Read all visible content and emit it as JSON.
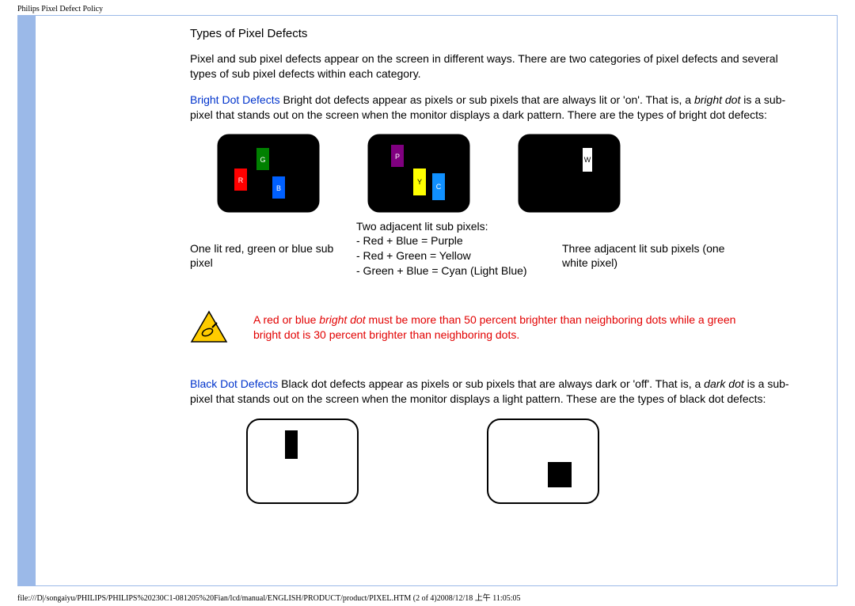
{
  "header": {
    "title": "Philips Pixel Defect Policy"
  },
  "section": {
    "heading": "Types of Pixel Defects",
    "intro": "Pixel and sub pixel defects appear on the screen in different ways. There are two categories of pixel defects and several types of sub pixel defects within each category.",
    "bright_label": "Bright Dot Defects",
    "bright_text_1": " Bright dot defects appear as pixels or sub pixels that are always lit or 'on'. That is, a ",
    "bright_em": "bright dot",
    "bright_text_2": " is a sub-pixel that stands out on the screen when the monitor displays a dark pattern. There are the types of bright dot defects:",
    "captions": {
      "c1": "One lit red, green or blue sub pixel",
      "c2_hdr": "Two adjacent lit sub pixels:",
      "c2_l1": "- Red + Blue = Purple",
      "c2_l2": "- Red + Green = Yellow",
      "c2_l3": "- Green + Blue = Cyan (Light Blue)",
      "c3": "Three adjacent lit sub pixels (one white pixel)"
    },
    "warning_1": "A red or blue ",
    "warning_em": "bright dot",
    "warning_2": " must be more than 50 percent brighter than neighboring dots while a green bright dot is 30 percent brighter than neighboring dots.",
    "black_label": "Black Dot Defects",
    "black_text_1": " Black dot defects appear as pixels or sub pixels that are always dark or 'off'. That is, a ",
    "black_em": "dark dot",
    "black_text_2": " is a sub-pixel that stands out on the screen when the monitor displays a light pattern. These are the types of black dot defects:"
  },
  "footer": {
    "path": "file:///D|/songaiyu/PHILIPS/PHILIPS%20230C1-081205%20Fian/lcd/manual/ENGLISH/PRODUCT/product/PIXEL.HTM (2 of 4)2008/12/18 上午 11:05:05"
  }
}
